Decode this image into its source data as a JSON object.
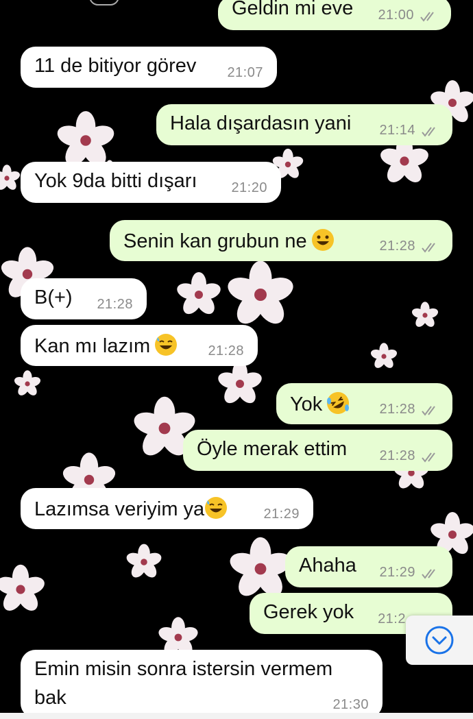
{
  "chat": {
    "messages": [
      {
        "dir": "out",
        "text": "Geldin mi eve",
        "time": "21:00"
      },
      {
        "dir": "in",
        "text": "11 de bitiyor görev",
        "time": "21:07"
      },
      {
        "dir": "out",
        "text": "Hala dışardasın yani",
        "time": "21:14"
      },
      {
        "dir": "in",
        "text": "Yok 9da bitti dışarı",
        "time": "21:20"
      },
      {
        "dir": "out",
        "text": "Senin kan grubun ne",
        "time": "21:28",
        "emoji": "grinning-face"
      },
      {
        "dir": "in",
        "text": "B(+)",
        "time": "21:28"
      },
      {
        "dir": "in",
        "text": "Kan mı lazım",
        "time": "21:28",
        "emoji": "sweat-smile-face"
      },
      {
        "dir": "out",
        "text": "Yok",
        "time": "21:28",
        "emoji": "rofl-face"
      },
      {
        "dir": "out",
        "text": "Öyle merak ettim",
        "time": "21:28"
      },
      {
        "dir": "in",
        "text": "Lazımsa veriyim ya",
        "time": "21:29",
        "emoji": "sweat-smile-face"
      },
      {
        "dir": "out",
        "text": "Ahaha",
        "time": "21:29"
      },
      {
        "dir": "out",
        "text": "Gerek yok",
        "time": "21:2"
      },
      {
        "dir": "in",
        "text": "Emin misin sonra istersin vermem",
        "text2": "bak",
        "time": "21:30"
      }
    ]
  },
  "colors": {
    "incoming_bubble": "#ffffff",
    "outgoing_bubble": "#e7fdd3",
    "background": "#000000",
    "read_ticks": "#9a9a9a"
  },
  "scroll_button": {
    "icon": "chevron-down-circle-icon"
  }
}
